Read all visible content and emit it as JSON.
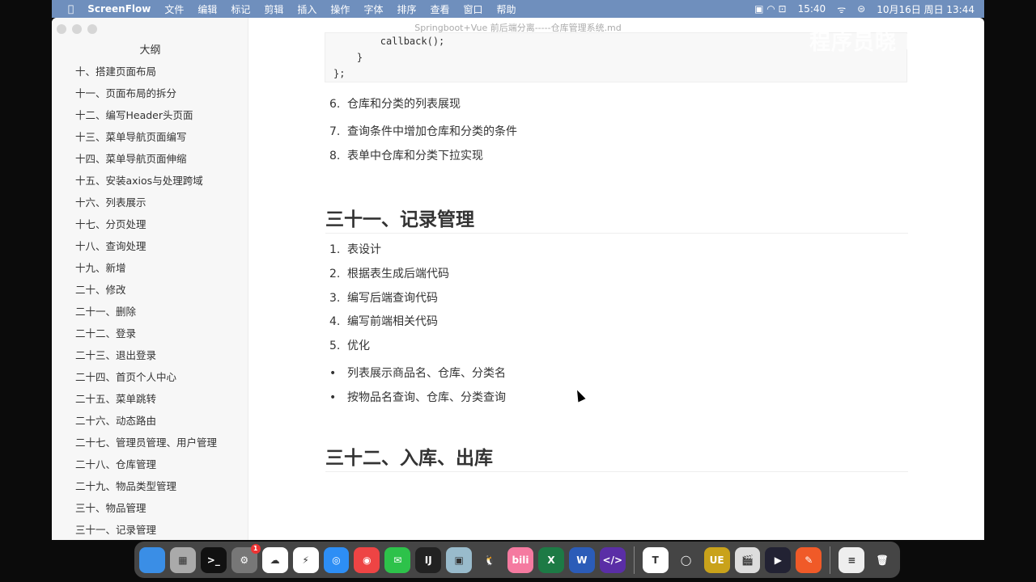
{
  "menubar": {
    "app": "ScreenFlow",
    "items": [
      "文件",
      "编辑",
      "标记",
      "剪辑",
      "插入",
      "操作",
      "字体",
      "排序",
      "查看",
      "窗口",
      "帮助"
    ],
    "battery_time": "15:40",
    "datetime": "10月16日 周日 13:44"
  },
  "window": {
    "title": "Springboot+Vue 前后端分离-----仓库管理系统.md"
  },
  "sidebar": {
    "title": "大纲",
    "items": [
      "十、搭建页面布局",
      "十一、页面布局的拆分",
      "十二、编写Header头页面",
      "十三、菜单导航页面编写",
      "十四、菜单导航页面伸缩",
      "十五、安装axios与处理跨域",
      "十六、列表展示",
      "十七、分页处理",
      "十八、查询处理",
      "十九、新增",
      "二十、修改",
      "二十一、删除",
      "二十二、登录",
      "二十三、退出登录",
      "二十四、首页个人中心",
      "二十五、菜单跳转",
      "二十六、动态路由",
      "二十七、管理员管理、用户管理",
      "二十八、仓库管理",
      "二十九、物品类型管理",
      "三十、物品管理",
      "三十一、记录管理"
    ]
  },
  "content": {
    "code_lines": [
      "        callback();",
      "    }",
      "};"
    ],
    "list_a": [
      {
        "n": "6.",
        "t": "仓库和分类的列表展现"
      },
      {
        "n": "7.",
        "t": "查询条件中增加仓库和分类的条件"
      },
      {
        "n": "8.",
        "t": "表单中仓库和分类下拉实现"
      }
    ],
    "heading1": "三十一、记录管理",
    "list_b": [
      {
        "n": "1.",
        "t": "表设计"
      },
      {
        "n": "2.",
        "t": "根据表生成后端代码"
      },
      {
        "n": "3.",
        "t": "编写后端查询代码"
      },
      {
        "n": "4.",
        "t": "编写前端相关代码"
      },
      {
        "n": "5.",
        "t": "优化"
      }
    ],
    "bullets": [
      {
        "n": "•",
        "t": "列表展示商品名、仓库、分类名"
      },
      {
        "n": "•",
        "t": "按物品名查询、仓库、分类查询"
      }
    ],
    "heading2": "三十二、入库、出库"
  },
  "watermark": "程序员晓 bilibili",
  "dock": {
    "apps": [
      {
        "name": "finder",
        "label": "",
        "color": "#3a8ee6"
      },
      {
        "name": "launchpad",
        "label": "▦",
        "color": "#aaa"
      },
      {
        "name": "terminal",
        "label": ">_",
        "color": "#111"
      },
      {
        "name": "system-settings",
        "label": "⚙",
        "color": "#777",
        "badge": "1"
      },
      {
        "name": "baidu-netdisk",
        "label": "☁",
        "color": "#fff"
      },
      {
        "name": "editor",
        "label": "⚡",
        "color": "#fff"
      },
      {
        "name": "safari",
        "label": "◎",
        "color": "#2d8ef5"
      },
      {
        "name": "chrome",
        "label": "◉",
        "color": "#e44"
      },
      {
        "name": "wechat",
        "label": "✉",
        "color": "#2dc24a"
      },
      {
        "name": "intellij",
        "label": "IJ",
        "color": "#222"
      },
      {
        "name": "preview",
        "label": "▣",
        "color": "#9bc"
      },
      {
        "name": "qq",
        "label": "🐧",
        "color": "transparent"
      },
      {
        "name": "bilibili",
        "label": "bili",
        "color": "#f57aa0"
      },
      {
        "name": "excel",
        "label": "X",
        "color": "#1d7a45"
      },
      {
        "name": "word",
        "label": "W",
        "color": "#2b5cb8"
      },
      {
        "name": "devtool",
        "label": "</>",
        "color": "#5a2ea6"
      },
      {
        "sep": true
      },
      {
        "name": "typora",
        "label": "T",
        "color": "#fff"
      },
      {
        "name": "app-rings",
        "label": "◯",
        "color": "transparent"
      },
      {
        "name": "ultraedit",
        "label": "UE",
        "color": "#c9a21a"
      },
      {
        "name": "screenflow",
        "label": "🎬",
        "color": "#ddd"
      },
      {
        "name": "player",
        "label": "▶",
        "color": "#223"
      },
      {
        "name": "postman",
        "label": "✎",
        "color": "#f05a28"
      },
      {
        "sep": true
      },
      {
        "name": "document",
        "label": "≡",
        "color": "#eee"
      },
      {
        "name": "trash",
        "label": "🗑",
        "color": "transparent"
      }
    ]
  }
}
